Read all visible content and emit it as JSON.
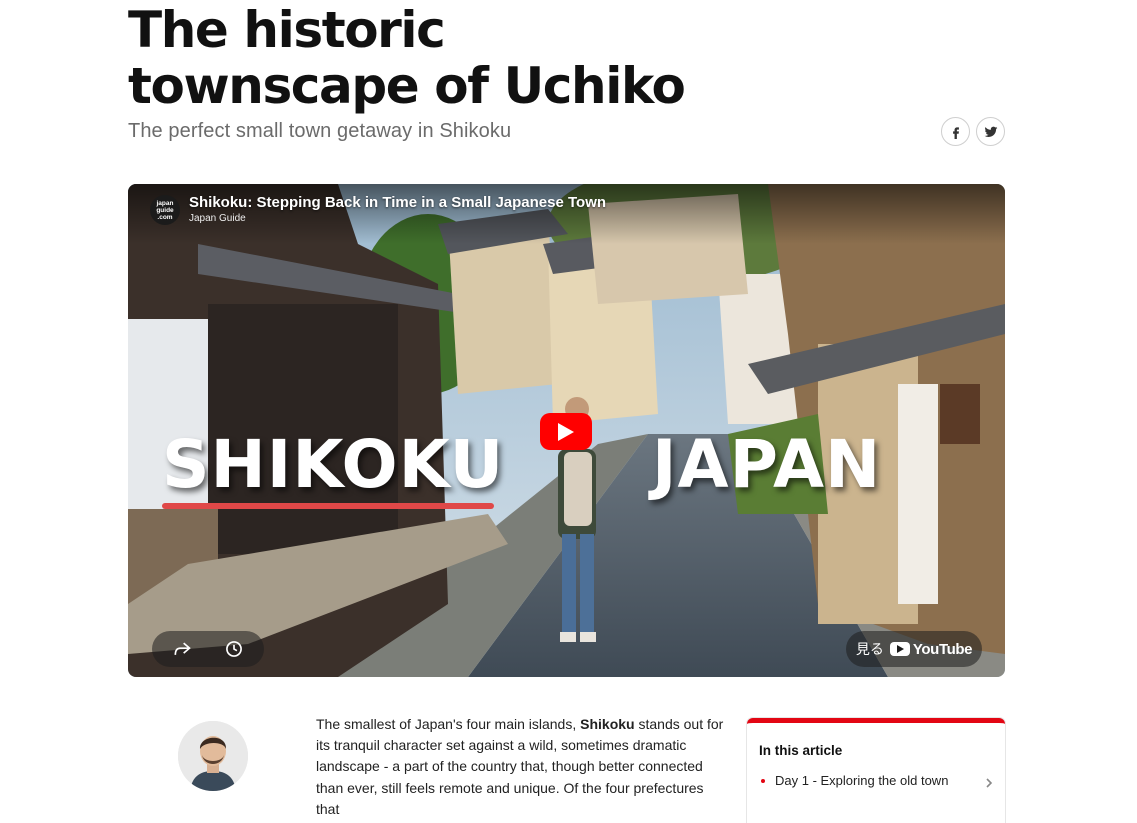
{
  "article": {
    "title": "The historic townscape of Uchiko",
    "subtitle": "The perfect small town getaway in Shikoku"
  },
  "social": {
    "facebook_icon": "facebook-icon",
    "twitter_icon": "twitter-icon"
  },
  "video": {
    "title": "Shikoku: Stepping Back in Time in a Small Japanese Town",
    "channel": "Japan Guide",
    "channel_logo_text": "japan guide .com",
    "overlay_left": "SHIKOKU",
    "overlay_right": "JAPAN",
    "watch_label": "見る",
    "youtube_label": "YouTube",
    "colors": {
      "play_button": "#ff0000",
      "underline": "#e04848"
    }
  },
  "body": {
    "intro_before": "The smallest of Japan's four main islands, ",
    "intro_bold": "Shikoku",
    "intro_after": " stands out for its tranquil character set against a wild, sometimes dramatic landscape - a part of the country that, though better connected than ever, still feels remote and unique. Of the four prefectures that"
  },
  "toc": {
    "heading": "In this article",
    "items": [
      {
        "label": "Day 1 - Exploring the old town"
      }
    ],
    "accent": "#e30613"
  }
}
